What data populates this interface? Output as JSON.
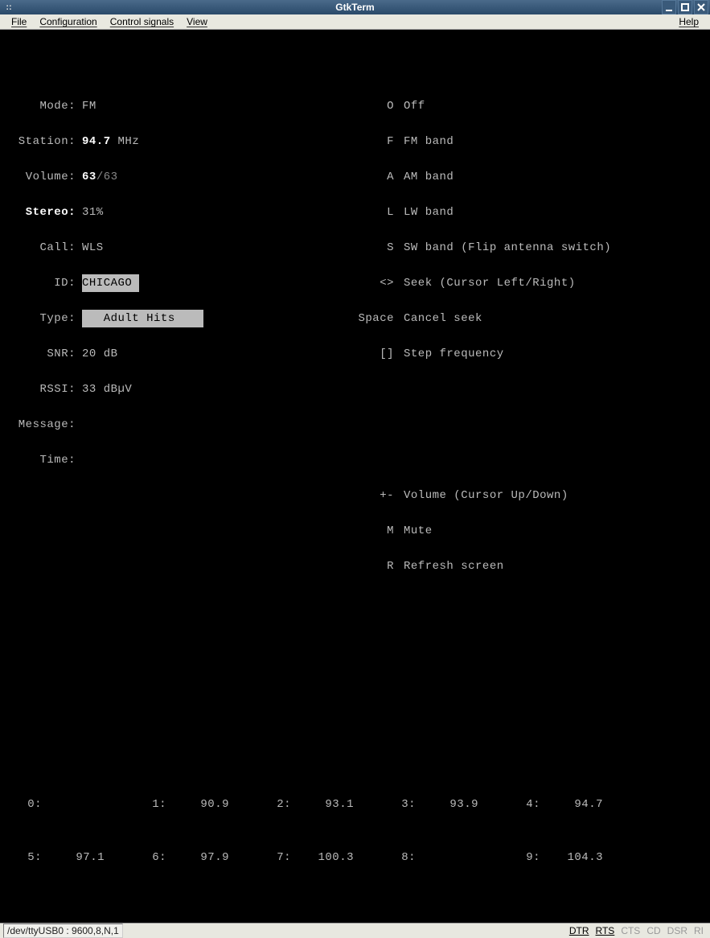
{
  "window": {
    "title": "GtkTerm"
  },
  "menubar": {
    "file": "File",
    "configuration": "Configuration",
    "control_signals": "Control signals",
    "view": "View",
    "help": "Help"
  },
  "status": {
    "labels": {
      "mode": "Mode:",
      "station": "Station:",
      "volume": "Volume:",
      "stereo": "Stereo:",
      "call": "Call:",
      "id": "ID:",
      "type": "Type:",
      "snr": "SNR:",
      "rssi": "RSSI:",
      "message": "Message:",
      "time": "Time:"
    },
    "mode": "FM",
    "station_freq": "94.7",
    "station_unit": " MHz",
    "volume_current": "63",
    "volume_max": "/63",
    "stereo": "31%",
    "call": "WLS",
    "id": "CHICAGO ",
    "type": "   Adult Hits    ",
    "snr": "20 dB",
    "rssi": "33 dBµV",
    "message": "",
    "time": ""
  },
  "help": {
    "off": {
      "key": "O",
      "text": "Off"
    },
    "fm": {
      "key": "F",
      "text": "FM band"
    },
    "am": {
      "key": "A",
      "text": "AM band"
    },
    "lw": {
      "key": "L",
      "text": "LW band"
    },
    "sw": {
      "key": "S",
      "text": "SW band (Flip antenna switch)"
    },
    "seek": {
      "key": "<>",
      "text": "Seek (Cursor Left/Right)"
    },
    "cancel": {
      "key": "Space",
      "text": "Cancel seek"
    },
    "step": {
      "key": "[]",
      "text": "Step frequency"
    },
    "volume": {
      "key": "+-",
      "text": "Volume (Cursor Up/Down)"
    },
    "mute": {
      "key": "M",
      "text": "Mute"
    },
    "refresh": {
      "key": "R",
      "text": "Refresh screen"
    }
  },
  "presets": [
    {
      "key": "0:",
      "val": ""
    },
    {
      "key": "1:",
      "val": "90.9"
    },
    {
      "key": "2:",
      "val": "93.1"
    },
    {
      "key": "3:",
      "val": "93.9"
    },
    {
      "key": "4:",
      "val": "94.7"
    },
    {
      "key": "5:",
      "val": "97.1"
    },
    {
      "key": "6:",
      "val": "97.9"
    },
    {
      "key": "7:",
      "val": "100.3"
    },
    {
      "key": "8:",
      "val": ""
    },
    {
      "key": "9:",
      "val": "104.3"
    }
  ],
  "statusbar": {
    "device": "/dev/ttyUSB0 : 9600,8,N,1",
    "signals": {
      "dtr": "DTR",
      "rts": "RTS",
      "cts": "CTS",
      "cd": "CD",
      "dsr": "DSR",
      "ri": "RI"
    }
  }
}
